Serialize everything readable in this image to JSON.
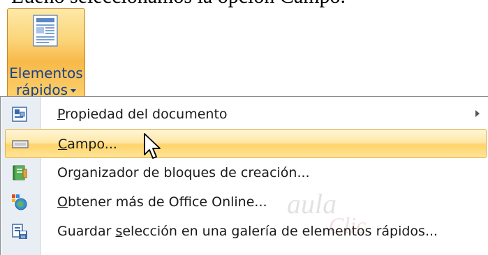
{
  "caption": {
    "text": "Lueno seleccionamos la opción Campo."
  },
  "ribbon": {
    "button": {
      "label_line1": "Elementos",
      "label_line2": "rápidos",
      "icon": "quick-parts-icon"
    }
  },
  "menu": {
    "items": [
      {
        "label_pre": "",
        "mnemonic": "P",
        "label_post": "ropiedad del documento",
        "icon": "document-property-icon",
        "has_submenu": true
      },
      {
        "label_pre": "",
        "mnemonic": "C",
        "label_post": "ampo...",
        "icon": "field-icon",
        "has_submenu": false
      },
      {
        "label_pre": "Or",
        "mnemonic": "g",
        "label_post": "anizador de bloques de creación...",
        "icon": "building-blocks-icon",
        "has_submenu": false
      },
      {
        "label_pre": "",
        "mnemonic": "O",
        "label_post": "btener más de Office Online...",
        "icon": "office-online-icon",
        "has_submenu": false
      },
      {
        "label_pre": "Guardar ",
        "mnemonic": "s",
        "label_post": "elección en una galería de elementos rápidos...",
        "icon": "save-selection-icon",
        "has_submenu": false
      }
    ]
  },
  "watermark": {
    "line1": "aula",
    "line2": "Clic"
  },
  "colors": {
    "ribbon_accent": "#f8b94a",
    "highlight": "#ffd46a",
    "label_blue": "#15428b"
  }
}
